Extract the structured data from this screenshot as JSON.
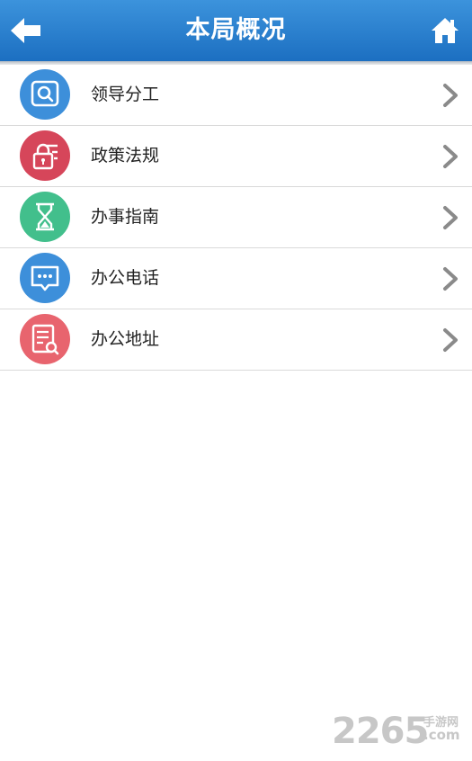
{
  "header": {
    "title": "本局概况",
    "back_icon": "back-arrow-icon",
    "home_icon": "home-icon"
  },
  "menu": [
    {
      "label": "领导分工",
      "icon": "magnifier-card-icon",
      "color": "#3d8fda"
    },
    {
      "label": "政策法规",
      "icon": "lock-document-icon",
      "color": "#d6465a"
    },
    {
      "label": "办事指南",
      "icon": "hourglass-icon",
      "color": "#42bf8c"
    },
    {
      "label": "办公电话",
      "icon": "chat-bubble-icon",
      "color": "#3d8fda"
    },
    {
      "label": "办公地址",
      "icon": "document-search-icon",
      "color": "#e8646e"
    }
  ],
  "watermark": {
    "number": "2265",
    "site_cn": "手游网",
    "site_com": ".com"
  },
  "colors": {
    "header_top": "#3c93dc",
    "header_bottom": "#1c6fc1",
    "chevron": "#8a8a8a",
    "divider": "#d9d9d9"
  }
}
